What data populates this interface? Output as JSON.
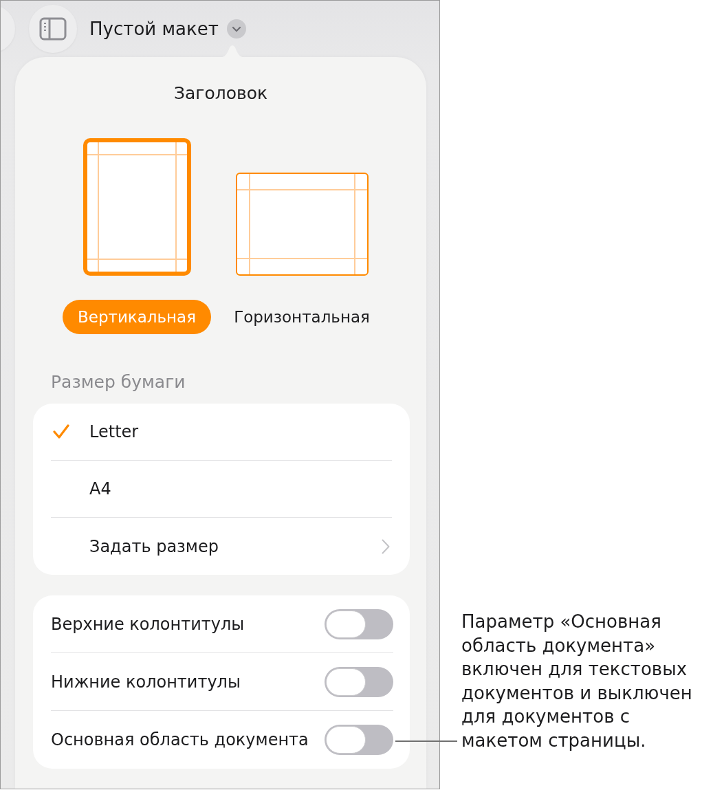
{
  "toolbar": {
    "title": "Пустой макет"
  },
  "popover": {
    "title": "Заголовок",
    "orientations": [
      {
        "kind": "portrait",
        "label": "Вертикальная",
        "selected": true
      },
      {
        "kind": "landscape",
        "label": "Горизонтальная",
        "selected": false
      }
    ],
    "paper_size": {
      "heading": "Размер бумаги",
      "options": [
        {
          "kind": "option",
          "label": "Letter",
          "selected": true
        },
        {
          "kind": "option",
          "label": "A4",
          "selected": false
        },
        {
          "kind": "link",
          "label": "Задать размер"
        }
      ]
    },
    "toggles": [
      {
        "label": "Верхние колонтитулы",
        "on": false
      },
      {
        "label": "Нижние колонтитулы",
        "on": false
      },
      {
        "label": "Основная область документа",
        "on": false
      }
    ]
  },
  "callout": {
    "lines": [
      "Параметр «Основная",
      "область документа»",
      "включен для текстовых",
      "документов и выключен",
      "для документов с",
      "макетом страницы."
    ]
  }
}
